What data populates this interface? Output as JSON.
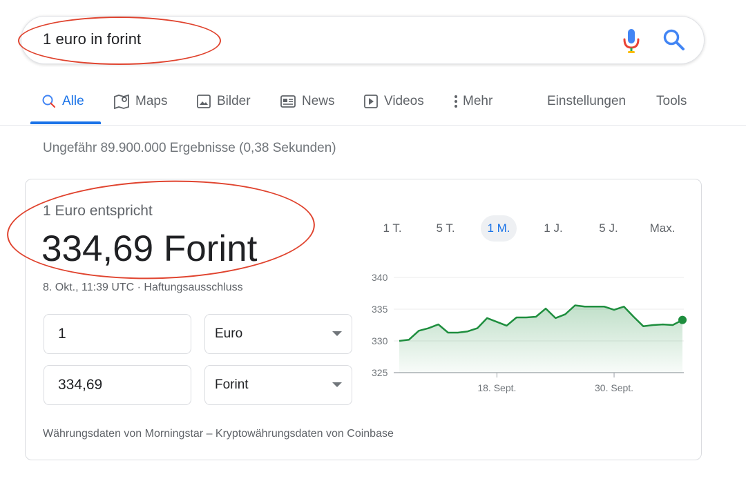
{
  "search": {
    "query": "1 euro in forint"
  },
  "tabs": [
    {
      "label": "Alle",
      "icon": "search-icon",
      "active": true
    },
    {
      "label": "Maps",
      "icon": "map-icon"
    },
    {
      "label": "Bilder",
      "icon": "image-icon"
    },
    {
      "label": "News",
      "icon": "news-icon"
    },
    {
      "label": "Videos",
      "icon": "play-icon"
    },
    {
      "label": "Mehr",
      "icon": "more-vert-icon"
    }
  ],
  "settings_label": "Einstellungen",
  "tools_label": "Tools",
  "result_stats": "Ungefähr 89.900.000 Ergebnisse (0,38 Sekunden)",
  "converter": {
    "equals_label": "1 Euro entspricht",
    "result": "334,69 Forint",
    "timestamp": "8. Okt., 11:39 UTC · Haftungsausschluss",
    "from_amount": "1",
    "from_currency": "Euro",
    "to_amount": "334,69",
    "to_currency": "Forint",
    "ranges": [
      "1 T.",
      "5 T.",
      "1 M.",
      "1 J.",
      "5 J.",
      "Max."
    ],
    "active_range": "1 M.",
    "source": "Währungsdaten von Morningstar – Kryptowährungsdaten von Coinbase"
  },
  "colors": {
    "accent": "#1a73e8",
    "annotation": "#e0442f",
    "chart_line": "#1e8e3e"
  },
  "chart_data": {
    "type": "area",
    "y_ticks": [
      "340",
      "335",
      "330",
      "325"
    ],
    "ylim": [
      325,
      340
    ],
    "x_tick_labels": [
      "18. Sept.",
      "30. Sept."
    ],
    "x_tick_index": [
      10,
      22
    ],
    "values": [
      330.0,
      330.2,
      331.6,
      332.0,
      332.6,
      331.3,
      331.3,
      331.5,
      332.0,
      333.6,
      333.0,
      332.4,
      333.7,
      333.7,
      333.8,
      335.1,
      333.6,
      334.2,
      335.6,
      335.4,
      335.4,
      335.4,
      334.9,
      335.4,
      333.8,
      332.3,
      332.5,
      332.6,
      332.5,
      333.3
    ],
    "grid": true,
    "last_point_marker": true
  }
}
